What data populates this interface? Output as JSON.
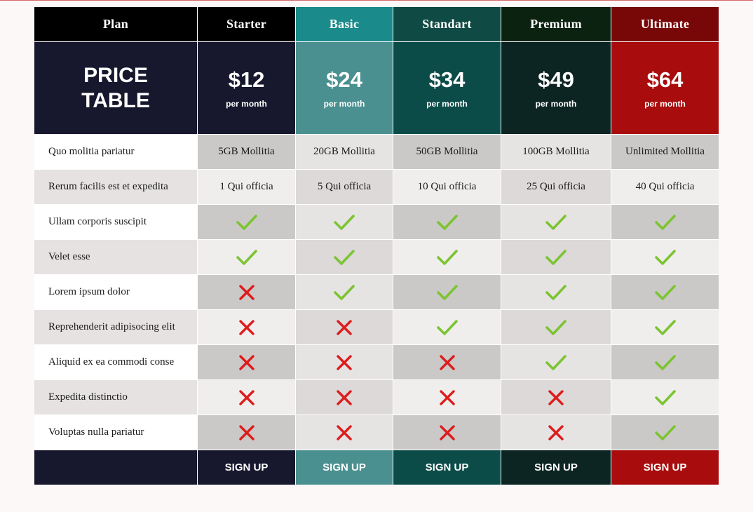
{
  "header": {
    "plan_label": "Plan",
    "title_line1": "PRICE",
    "title_line2": "TABLE"
  },
  "plans": [
    {
      "name": "Starter",
      "price": "$12",
      "period": "per month",
      "cta": "SIGN UP"
    },
    {
      "name": "Basic",
      "price": "$24",
      "period": "per month",
      "cta": "SIGN UP"
    },
    {
      "name": "Standart",
      "price": "$34",
      "period": "per month",
      "cta": "SIGN UP"
    },
    {
      "name": "Premium",
      "price": "$49",
      "period": "per month",
      "cta": "SIGN UP"
    },
    {
      "name": "Ultimate",
      "price": "$64",
      "period": "per month",
      "cta": "SIGN UP"
    }
  ],
  "features": [
    {
      "label": "Quo molitia pariatur",
      "values": [
        "5GB Mollitia",
        "20GB Mollitia",
        "50GB Mollitia",
        "100GB Mollitia",
        "Unlimited Mollitia"
      ]
    },
    {
      "label": "Rerum facilis est et expedita",
      "values": [
        "1 Qui officia",
        "5 Qui officia",
        "10 Qui officia",
        "25 Qui officia",
        "40 Qui officia"
      ]
    },
    {
      "label": "Ullam corporis suscipit",
      "values": [
        true,
        true,
        true,
        true,
        true
      ]
    },
    {
      "label": "Velet esse",
      "values": [
        true,
        true,
        true,
        true,
        true
      ]
    },
    {
      "label": "Lorem ipsum dolor",
      "values": [
        false,
        true,
        true,
        true,
        true
      ]
    },
    {
      "label": "Reprehenderit adipisocing elit",
      "values": [
        false,
        false,
        true,
        true,
        true
      ]
    },
    {
      "label": "Aliquid ex ea commodi conse",
      "values": [
        false,
        false,
        false,
        true,
        true
      ]
    },
    {
      "label": "Expedita distinctio",
      "values": [
        false,
        false,
        false,
        false,
        true
      ]
    },
    {
      "label": "Voluptas nulla pariatur",
      "values": [
        false,
        false,
        false,
        false,
        true
      ]
    }
  ],
  "colors": {
    "header_row": [
      "#000000",
      "#000000",
      "#1a8a8a",
      "#104a44",
      "#0c2210",
      "#780808"
    ],
    "price_row": [
      "#17172e",
      "#17172e",
      "#4a9090",
      "#0c4c48",
      "#0c2422",
      "#a80c0c"
    ],
    "footer_row": [
      "#17172e",
      "#17172e",
      "#4a9090",
      "#0c4c48",
      "#0c2422",
      "#a80c0c"
    ],
    "check": "#7cc432",
    "cross": "#dd1c1c",
    "stripes_odd": [
      "#ffffff",
      "#cbc9c7",
      "#e6e4e3",
      "#cbc9c7",
      "#e6e4e3",
      "#cbc9c7"
    ],
    "stripes_even": [
      "#e6e2e2",
      "#efeeec",
      "#dcd9d8",
      "#efeeec",
      "#dcd9d8",
      "#efeeec"
    ]
  },
  "icons": {
    "included": "check-icon",
    "excluded": "cross-icon"
  }
}
